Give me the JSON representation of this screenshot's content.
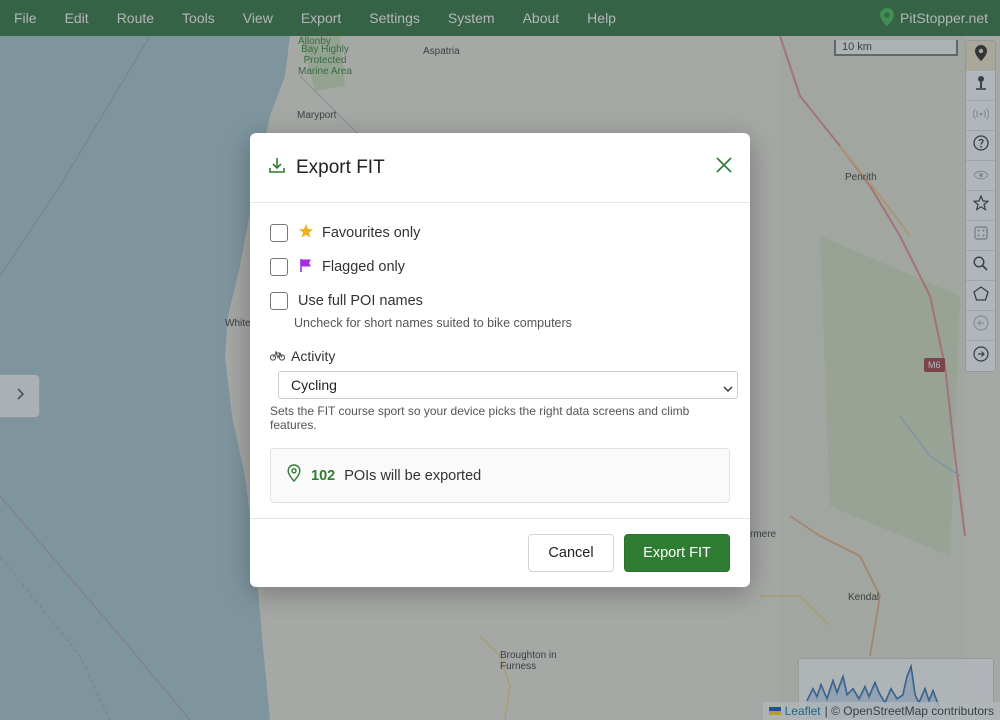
{
  "menu": {
    "items": [
      "File",
      "Edit",
      "Route",
      "Tools",
      "View",
      "Export",
      "Settings",
      "System",
      "About",
      "Help"
    ],
    "brand": "PitStopper.net"
  },
  "map": {
    "scale_label": "10 km",
    "road_shield": "M6",
    "places": {
      "aspatria": "Aspatria",
      "maryport": "Maryport",
      "aonb": "Bay Highly Protected Marine Area",
      "aonb_top": "Allonby",
      "penrith": "Penrith",
      "whitehaven": "White",
      "windermere": "rmere",
      "kendal": "Kendal",
      "broughton": "Broughton in Furness"
    },
    "attribution": {
      "leaflet": "Leaflet",
      "rest": "| © OpenStreetMap contributors"
    }
  },
  "toolbar": {
    "icons": [
      "marker-icon",
      "person-pin-icon",
      "broadcast-icon",
      "help-icon",
      "eye-icon",
      "star-icon",
      "dice-icon",
      "search-icon",
      "polygon-icon",
      "back-icon",
      "forward-icon"
    ]
  },
  "dialog": {
    "title": "Export FIT",
    "options": {
      "favourites": "Favourites only",
      "flagged": "Flagged only",
      "full_names": "Use full POI names",
      "full_names_hint": "Uncheck for short names suited to bike computers"
    },
    "activity": {
      "label": "Activity",
      "selected": "Cycling",
      "help": "Sets the FIT course sport so your device picks the right data screens and climb features."
    },
    "summary": {
      "count": "102",
      "text": "POIs will be exported"
    },
    "buttons": {
      "cancel": "Cancel",
      "export": "Export FIT"
    }
  },
  "colors": {
    "brand_green": "#2e7d32",
    "menubar": "#2c6e36",
    "star": "#f2b01e",
    "flag": "#a42be0"
  }
}
